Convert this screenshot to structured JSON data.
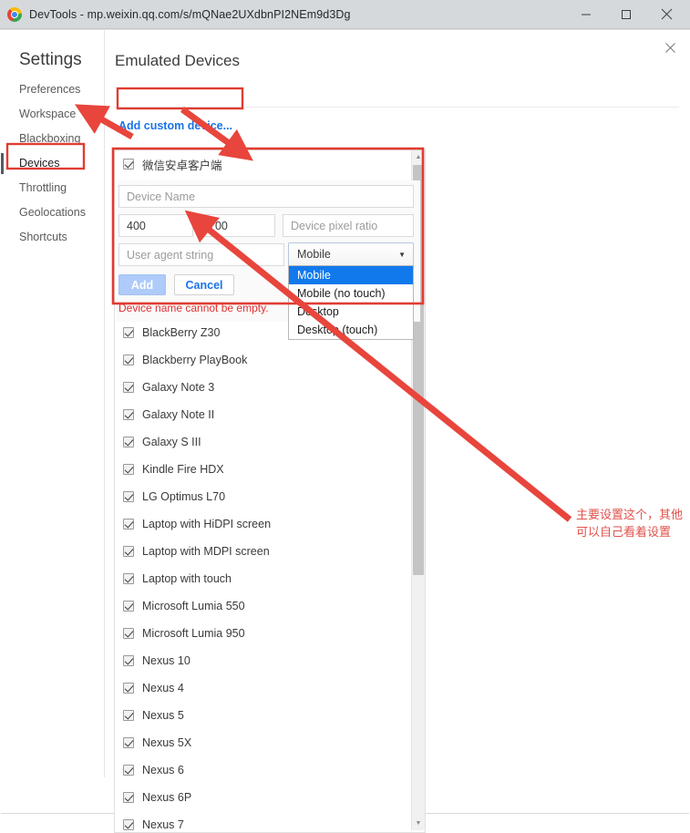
{
  "window": {
    "title": "DevTools - mp.weixin.qq.com/s/mQNae2UXdbnPI2NEm9d3Dg",
    "minimize_glyph": "─",
    "maximize_glyph": "☐",
    "close_glyph": "✕",
    "app_icon": "chrome-icon"
  },
  "panel": {
    "close_glyph": "✕"
  },
  "sidebar": {
    "heading": "Settings",
    "items": [
      {
        "label": "Preferences",
        "selected": false
      },
      {
        "label": "Workspace",
        "selected": false
      },
      {
        "label": "Blackboxing",
        "selected": false
      },
      {
        "label": "Devices",
        "selected": true
      },
      {
        "label": "Throttling",
        "selected": false
      },
      {
        "label": "Geolocations",
        "selected": false
      },
      {
        "label": "Shortcuts",
        "selected": false
      }
    ]
  },
  "main": {
    "title": "Emulated Devices",
    "add_custom_device": "Add custom device..."
  },
  "device_form": {
    "device_name_placeholder": "Device Name",
    "device_name_value": "",
    "width_value": "400",
    "height_value": "700",
    "dpr_placeholder": "Device pixel ratio",
    "dpr_value": "",
    "ua_placeholder": "User agent string",
    "ua_value": "",
    "ua_type_selected": "Mobile",
    "ua_type_options": [
      {
        "label": "Mobile",
        "selected": true
      },
      {
        "label": "Mobile (no touch)",
        "selected": false
      },
      {
        "label": "Desktop",
        "selected": false
      },
      {
        "label": "Desktop (touch)",
        "selected": false
      }
    ],
    "caret_glyph": "▼",
    "add_label": "Add",
    "cancel_label": "Cancel",
    "error_message": "Device name cannot be empty."
  },
  "devices": [
    {
      "label": "微信安卓客户端",
      "checked": true
    },
    {
      "label": "BlackBerry Z30",
      "checked": true
    },
    {
      "label": "Blackberry PlayBook",
      "checked": true
    },
    {
      "label": "Galaxy Note 3",
      "checked": true
    },
    {
      "label": "Galaxy Note II",
      "checked": true
    },
    {
      "label": "Galaxy S III",
      "checked": true
    },
    {
      "label": "Kindle Fire HDX",
      "checked": true
    },
    {
      "label": "LG Optimus L70",
      "checked": true
    },
    {
      "label": "Laptop with HiDPI screen",
      "checked": true
    },
    {
      "label": "Laptop with MDPI screen",
      "checked": true
    },
    {
      "label": "Laptop with touch",
      "checked": true
    },
    {
      "label": "Microsoft Lumia 550",
      "checked": true
    },
    {
      "label": "Microsoft Lumia 950",
      "checked": true
    },
    {
      "label": "Nexus 10",
      "checked": true
    },
    {
      "label": "Nexus 4",
      "checked": true
    },
    {
      "label": "Nexus 5",
      "checked": true
    },
    {
      "label": "Nexus 5X",
      "checked": true
    },
    {
      "label": "Nexus 6",
      "checked": true
    },
    {
      "label": "Nexus 6P",
      "checked": true
    },
    {
      "label": "Nexus 7",
      "checked": true
    }
  ],
  "scrollbar": {
    "up_glyph": "▲",
    "down_glyph": "▼"
  },
  "annotation": {
    "note_text": "主要设置这个，其他可以自己看着设置",
    "color": "#e0524c",
    "box_color": "#e03c32"
  }
}
